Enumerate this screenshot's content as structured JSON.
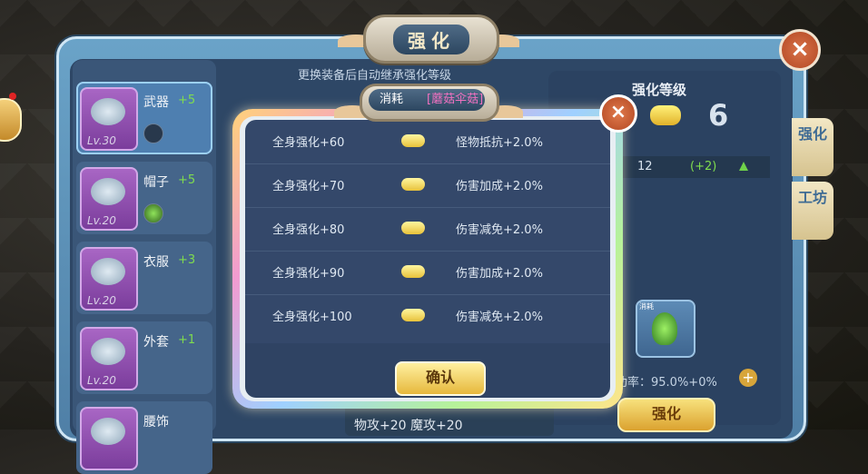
{
  "window": {
    "title": "强化",
    "close_label": "×"
  },
  "hint": "更换装备后自动继承强化等级",
  "equipment": [
    {
      "name": "武器",
      "plus": "+5",
      "lv": "Lv.30"
    },
    {
      "name": "帽子",
      "plus": "+5",
      "lv": "Lv.20"
    },
    {
      "name": "衣服",
      "plus": "+3",
      "lv": "Lv.20"
    },
    {
      "name": "外套",
      "plus": "+1",
      "lv": "Lv.20"
    },
    {
      "name": "腰饰",
      "plus": "",
      "lv": ""
    }
  ],
  "enhance_panel": {
    "title": "强化等级",
    "level": "6",
    "stat_value": "12",
    "stat_plus": "(+2)",
    "potion_tag": "消耗",
    "success_rate": "功率：95.0%+0%",
    "plus_label": "+",
    "button_label": "强化"
  },
  "side_tabs": [
    "强化",
    "工坊"
  ],
  "bottom_text": "物攻+20  魔攻+20",
  "modal": {
    "overlay_text": "消耗",
    "overlay_name": "[蘑菇伞菇]",
    "close_label": "×",
    "bonuses": [
      {
        "condition": "全身强化+60",
        "effect": "怪物抵抗+2.0%"
      },
      {
        "condition": "全身强化+70",
        "effect": "伤害加成+2.0%"
      },
      {
        "condition": "全身强化+80",
        "effect": "伤害减免+2.0%"
      },
      {
        "condition": "全身强化+90",
        "effect": "伤害加成+2.0%"
      },
      {
        "condition": "全身强化+100",
        "effect": "伤害减免+2.0%"
      }
    ],
    "confirm_label": "确认"
  },
  "colors": {
    "accent_gold": "#e6b83c",
    "plus_green": "#7fdd4e",
    "panel_blue": "#2e4766"
  }
}
